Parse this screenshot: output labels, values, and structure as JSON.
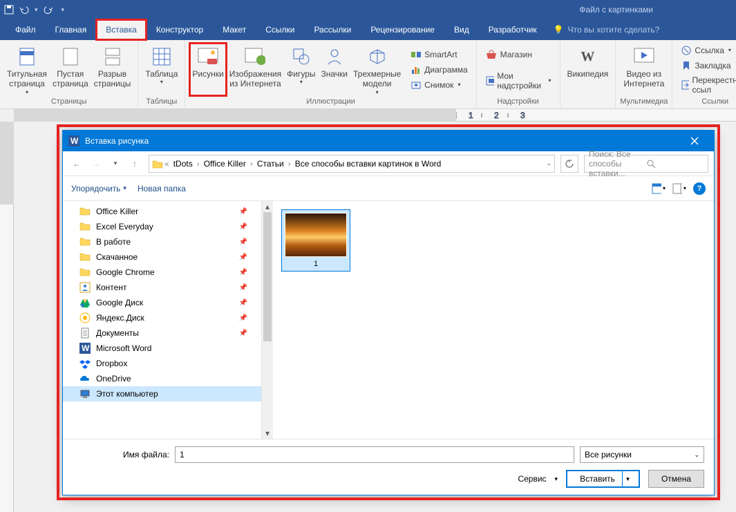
{
  "app": {
    "document_title": "Файл с картинками"
  },
  "qat": {
    "save": "save",
    "undo": "undo",
    "redo": "redo"
  },
  "menu": {
    "tabs": [
      "Файл",
      "Главная",
      "Вставка",
      "Конструктор",
      "Макет",
      "Ссылки",
      "Рассылки",
      "Рецензирование",
      "Вид",
      "Разработчик"
    ],
    "active_index": 2,
    "tellme": "Что вы хотите сделать?"
  },
  "ribbon": {
    "groups": [
      {
        "label": "Страницы",
        "buttons": [
          {
            "t": "Титульная\nстраница",
            "d": 1
          },
          {
            "t": "Пустая\nстраница"
          },
          {
            "t": "Разрыв\nстраницы"
          }
        ]
      },
      {
        "label": "Таблицы",
        "buttons": [
          {
            "t": "Таблица",
            "d": 1
          }
        ]
      },
      {
        "label": "Иллюстрации",
        "buttons": [
          {
            "t": "Рисунки",
            "hl": 1
          },
          {
            "t": "Изображения\nиз Интернета"
          },
          {
            "t": "Фигуры",
            "d": 1
          },
          {
            "t": "Значки"
          },
          {
            "t": "Трехмерные\nмодели",
            "d": 1
          }
        ],
        "stack": [
          {
            "t": "SmartArt"
          },
          {
            "t": "Диаграмма"
          },
          {
            "t": "Снимок",
            "d": 1
          }
        ]
      },
      {
        "label": "Надстройки",
        "stack": [
          {
            "t": "Магазин"
          },
          {
            "t": "Мои надстройки",
            "d": 1
          }
        ]
      },
      {
        "label": "",
        "buttons": [
          {
            "t": "Википедия"
          }
        ]
      },
      {
        "label": "Мультимедиа",
        "buttons": [
          {
            "t": "Видео из\nИнтернета"
          }
        ]
      },
      {
        "label": "Ссылки",
        "stack": [
          {
            "t": "Ссылка",
            "d": 1
          },
          {
            "t": "Закладка"
          },
          {
            "t": "Перекрестная ссыл"
          }
        ]
      }
    ]
  },
  "dialog": {
    "title": "Вставка рисунка",
    "breadcrumb": [
      "tDots",
      "Office Killer",
      "Статьи",
      "Все способы вставки картинок в Word"
    ],
    "search_placeholder": "Поиск: Все способы вставки...",
    "toolbar": {
      "organize": "Упорядочить",
      "newfolder": "Новая папка"
    },
    "tree": [
      {
        "t": "Office Killer",
        "ico": "folder",
        "pin": 1
      },
      {
        "t": "Excel Everyday",
        "ico": "folder",
        "pin": 1
      },
      {
        "t": "В работе",
        "ico": "folder",
        "pin": 1
      },
      {
        "t": "Скачанное",
        "ico": "folder",
        "pin": 1
      },
      {
        "t": "Google Chrome",
        "ico": "folder",
        "pin": 1
      },
      {
        "t": "Контент",
        "ico": "contact",
        "pin": 1
      },
      {
        "t": "Google Диск",
        "ico": "gdrive",
        "pin": 1
      },
      {
        "t": "Яндекс.Диск",
        "ico": "ydisk",
        "pin": 1
      },
      {
        "t": "Документы",
        "ico": "docs",
        "pin": 1
      },
      {
        "t": "Microsoft Word",
        "ico": "word"
      },
      {
        "t": "Dropbox",
        "ico": "dropbox"
      },
      {
        "t": "OneDrive",
        "ico": "onedrive"
      },
      {
        "t": "Этот компьютер",
        "ico": "pc",
        "sel": 1
      }
    ],
    "file": {
      "name": "1"
    },
    "footer": {
      "filename_label": "Имя файла:",
      "filename_value": "1",
      "filter": "Все рисунки",
      "service": "Сервис",
      "insert": "Вставить",
      "cancel": "Отмена"
    }
  }
}
